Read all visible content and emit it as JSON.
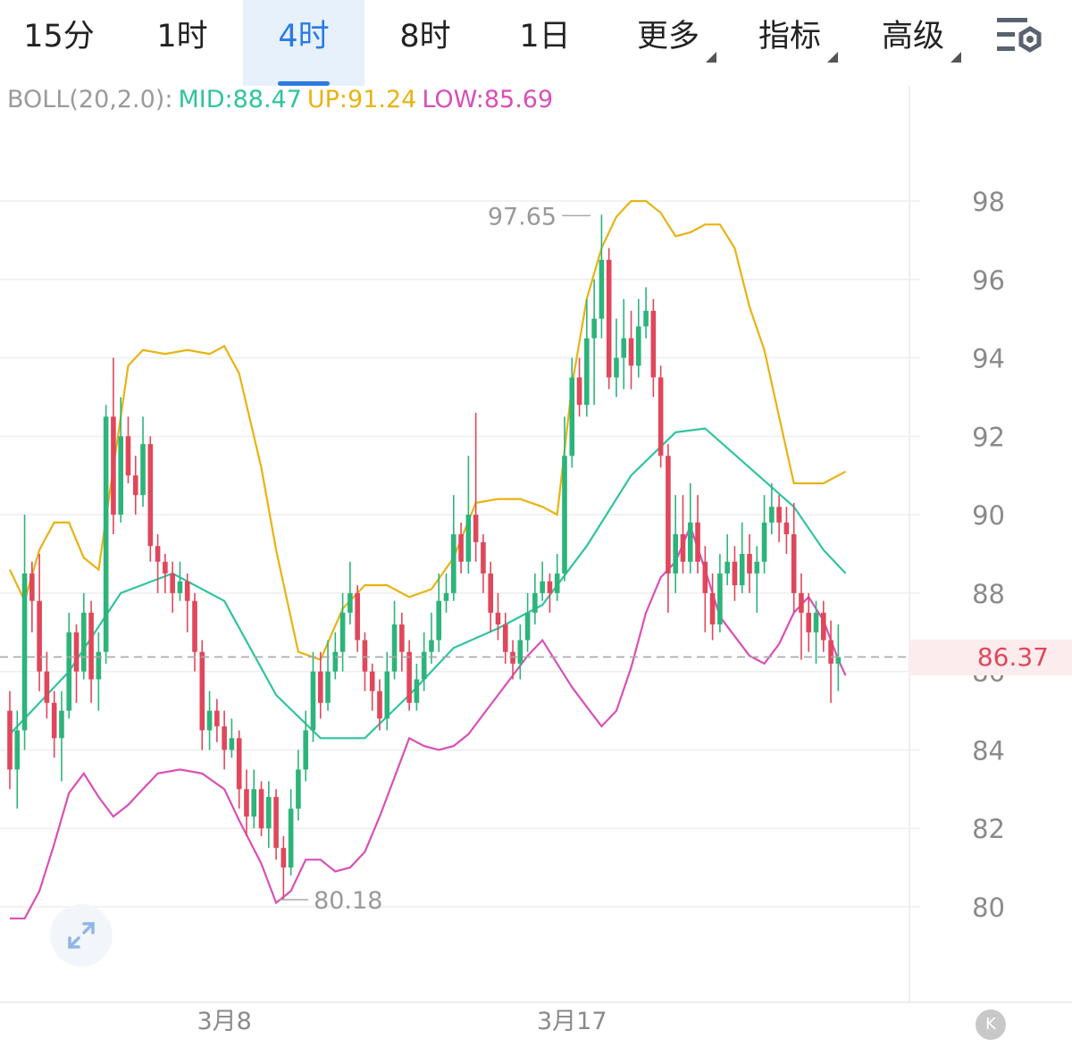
{
  "tabs": [
    {
      "label": "15分",
      "active": false,
      "dropdown": false
    },
    {
      "label": "1时",
      "active": false,
      "dropdown": false
    },
    {
      "label": "4时",
      "active": true,
      "dropdown": false
    },
    {
      "label": "8时",
      "active": false,
      "dropdown": false
    },
    {
      "label": "1日",
      "active": false,
      "dropdown": false
    },
    {
      "label": "更多",
      "active": false,
      "dropdown": true
    },
    {
      "label": "指标",
      "active": false,
      "dropdown": true
    },
    {
      "label": "高级",
      "active": false,
      "dropdown": true
    }
  ],
  "settings_icon": "chart-settings-icon",
  "indicator": {
    "name": "BOLL(20,2.0):",
    "mid_label": "MID:88.47",
    "up_label": "UP:91.24",
    "low_label": "LOW:85.69",
    "name_color": "#9a9a9a",
    "mid_color": "#2ec4a0",
    "up_color": "#e8b313",
    "low_color": "#d94fb7"
  },
  "current_price": "86.37",
  "expand_icon": "expand-icon",
  "k_button_icon": "k-line-icon",
  "chart_data": {
    "type": "candlestick",
    "ylim": [
      78.0,
      99.8
    ],
    "y_ticks": [
      "80",
      "82",
      "84",
      "86",
      "88",
      "90",
      "92",
      "94",
      "96",
      "98"
    ],
    "x_tick_labels": [
      {
        "label": "3月8",
        "index": 29
      },
      {
        "label": "3月17",
        "index": 76
      }
    ],
    "max_annotation": {
      "label": "97.65",
      "value": 97.65,
      "index": 79
    },
    "min_annotation": {
      "label": "80.18",
      "value": 80.18,
      "index": 36
    },
    "current_price_line": 86.37,
    "colors": {
      "up": "#2db47a",
      "down": "#e0475b",
      "mid": "#2ec4a0",
      "upper": "#e8b313",
      "lower": "#d94fb7",
      "grid": "#eeeeee",
      "axis_text": "#8a8a8a"
    },
    "candles": [
      [
        85.0,
        83.5,
        85.5,
        83.0
      ],
      [
        83.5,
        84.5,
        85.0,
        82.5
      ],
      [
        84.5,
        88.5,
        90.0,
        84.0
      ],
      [
        88.5,
        87.8,
        88.8,
        87.0
      ],
      [
        87.8,
        86.0,
        89.0,
        85.5
      ],
      [
        86.0,
        85.2,
        86.5,
        84.8
      ],
      [
        85.2,
        84.3,
        85.5,
        83.8
      ],
      [
        84.3,
        85.0,
        85.5,
        83.2
      ],
      [
        85.0,
        87.0,
        87.5,
        84.8
      ],
      [
        87.0,
        86.0,
        87.2,
        85.2
      ],
      [
        86.0,
        87.5,
        88.0,
        85.8
      ],
      [
        87.5,
        85.8,
        87.8,
        85.2
      ],
      [
        85.8,
        86.5,
        87.0,
        85.0
      ],
      [
        86.5,
        92.5,
        92.8,
        86.2
      ],
      [
        92.5,
        90.0,
        94.0,
        89.5
      ],
      [
        90.0,
        92.0,
        93.0,
        89.8
      ],
      [
        92.0,
        91.0,
        92.5,
        90.8
      ],
      [
        91.0,
        90.5,
        91.5,
        90.0
      ],
      [
        90.5,
        91.8,
        92.5,
        90.2
      ],
      [
        91.8,
        89.2,
        92.0,
        88.8
      ],
      [
        89.2,
        88.8,
        89.5,
        88.0
      ],
      [
        88.8,
        88.5,
        89.0,
        88.0
      ],
      [
        88.5,
        88.0,
        88.8,
        87.5
      ],
      [
        88.0,
        88.3,
        88.8,
        87.8
      ],
      [
        88.3,
        87.8,
        88.5,
        87.0
      ],
      [
        87.8,
        86.5,
        88.0,
        86.0
      ],
      [
        86.5,
        84.5,
        86.8,
        84.0
      ],
      [
        84.5,
        85.0,
        85.5,
        84.0
      ],
      [
        85.0,
        84.6,
        85.3,
        84.2
      ],
      [
        84.6,
        84.0,
        85.0,
        83.5
      ],
      [
        84.0,
        84.3,
        84.8,
        83.8
      ],
      [
        84.3,
        83.0,
        84.5,
        82.5
      ],
      [
        83.0,
        82.3,
        83.5,
        81.8
      ],
      [
        82.3,
        83.0,
        83.5,
        82.0
      ],
      [
        83.0,
        82.0,
        83.2,
        81.8
      ],
      [
        82.0,
        82.8,
        83.2,
        81.5
      ],
      [
        82.8,
        81.5,
        83.0,
        81.2
      ],
      [
        81.5,
        81.0,
        81.8,
        80.18
      ],
      [
        81.0,
        82.5,
        83.0,
        80.8
      ],
      [
        82.5,
        83.5,
        84.0,
        82.2
      ],
      [
        83.5,
        84.5,
        85.0,
        83.2
      ],
      [
        84.5,
        86.0,
        86.5,
        84.2
      ],
      [
        86.0,
        85.2,
        86.5,
        84.8
      ],
      [
        85.2,
        86.0,
        86.8,
        85.0
      ],
      [
        86.0,
        86.5,
        87.0,
        85.8
      ],
      [
        86.5,
        87.5,
        88.0,
        86.0
      ],
      [
        87.5,
        88.0,
        88.8,
        87.2
      ],
      [
        88.0,
        86.8,
        88.2,
        86.5
      ],
      [
        86.8,
        86.0,
        87.0,
        85.5
      ],
      [
        86.0,
        85.5,
        86.2,
        85.0
      ],
      [
        85.5,
        84.8,
        85.8,
        84.5
      ],
      [
        84.8,
        86.0,
        86.5,
        84.5
      ],
      [
        86.0,
        87.2,
        87.8,
        85.8
      ],
      [
        87.2,
        86.5,
        87.5,
        86.0
      ],
      [
        86.5,
        85.2,
        86.8,
        85.0
      ],
      [
        85.2,
        85.8,
        86.2,
        85.0
      ],
      [
        85.8,
        86.5,
        87.0,
        85.5
      ],
      [
        86.5,
        86.8,
        87.5,
        86.2
      ],
      [
        86.8,
        87.8,
        88.5,
        86.5
      ],
      [
        87.8,
        88.0,
        88.5,
        87.5
      ],
      [
        88.0,
        89.5,
        90.5,
        87.8
      ],
      [
        89.5,
        88.8,
        89.8,
        88.5
      ],
      [
        88.8,
        90.0,
        91.5,
        88.5
      ],
      [
        90.0,
        89.3,
        92.6,
        88.8
      ],
      [
        89.3,
        88.5,
        89.5,
        88.0
      ],
      [
        88.5,
        87.5,
        88.8,
        87.0
      ],
      [
        87.5,
        87.2,
        88.0,
        86.8
      ],
      [
        87.2,
        86.5,
        87.5,
        86.2
      ],
      [
        86.5,
        86.2,
        86.8,
        85.8
      ],
      [
        86.2,
        86.8,
        87.2,
        85.8
      ],
      [
        86.8,
        87.5,
        88.0,
        86.5
      ],
      [
        87.5,
        88.0,
        88.5,
        87.2
      ],
      [
        88.0,
        88.3,
        88.8,
        87.8
      ],
      [
        88.3,
        88.0,
        88.5,
        87.5
      ],
      [
        88.0,
        88.5,
        89.0,
        87.8
      ],
      [
        88.5,
        91.5,
        92.5,
        88.3
      ],
      [
        91.5,
        93.5,
        94.0,
        91.2
      ],
      [
        93.5,
        92.8,
        94.0,
        92.5
      ],
      [
        92.8,
        94.5,
        95.5,
        92.5
      ],
      [
        94.5,
        95.0,
        96.0,
        92.8
      ],
      [
        95.0,
        96.5,
        97.65,
        94.5
      ],
      [
        96.5,
        93.5,
        96.8,
        93.2
      ],
      [
        93.5,
        94.0,
        95.0,
        93.0
      ],
      [
        94.0,
        94.5,
        95.5,
        93.2
      ],
      [
        94.5,
        93.8,
        95.2,
        93.2
      ],
      [
        93.8,
        94.8,
        95.5,
        93.5
      ],
      [
        94.8,
        95.2,
        95.8,
        94.5
      ],
      [
        95.2,
        93.5,
        95.5,
        93.0
      ],
      [
        93.5,
        91.5,
        93.8,
        91.2
      ],
      [
        91.5,
        88.5,
        91.8,
        87.5
      ],
      [
        88.5,
        89.5,
        90.5,
        88.0
      ],
      [
        89.5,
        88.8,
        90.5,
        88.5
      ],
      [
        88.8,
        89.8,
        90.8,
        88.5
      ],
      [
        89.8,
        88.8,
        90.5,
        88.5
      ],
      [
        88.8,
        88.0,
        89.2,
        87.0
      ],
      [
        88.0,
        87.2,
        88.5,
        86.8
      ],
      [
        87.2,
        88.5,
        89.0,
        87.0
      ],
      [
        88.5,
        88.8,
        89.5,
        88.2
      ],
      [
        88.8,
        88.2,
        89.2,
        87.8
      ],
      [
        88.2,
        89.0,
        89.8,
        88.0
      ],
      [
        89.0,
        88.5,
        89.5,
        88.0
      ],
      [
        88.5,
        88.8,
        89.2,
        87.5
      ],
      [
        88.8,
        89.8,
        90.5,
        88.5
      ],
      [
        89.8,
        90.2,
        90.8,
        89.5
      ],
      [
        90.2,
        89.8,
        90.5,
        89.3
      ],
      [
        89.8,
        89.5,
        90.2,
        89.0
      ],
      [
        89.5,
        88.0,
        90.3,
        87.5
      ],
      [
        88.0,
        87.5,
        88.5,
        86.3
      ],
      [
        87.5,
        87.0,
        88.0,
        86.5
      ],
      [
        87.0,
        87.5,
        87.8,
        86.2
      ],
      [
        87.5,
        86.8,
        87.8,
        86.5
      ],
      [
        86.8,
        86.2,
        87.3,
        85.2
      ],
      [
        86.2,
        86.37,
        87.2,
        85.5
      ]
    ],
    "mid": [
      [
        0,
        84.4
      ],
      [
        8,
        86.0
      ],
      [
        15,
        88.0
      ],
      [
        22,
        88.5
      ],
      [
        29,
        87.8
      ],
      [
        36,
        85.4
      ],
      [
        42,
        84.3
      ],
      [
        48,
        84.3
      ],
      [
        54,
        85.4
      ],
      [
        60,
        86.6
      ],
      [
        66,
        87.1
      ],
      [
        72,
        87.7
      ],
      [
        78,
        89.2
      ],
      [
        84,
        91.0
      ],
      [
        90,
        92.1
      ],
      [
        94,
        92.2
      ],
      [
        100,
        91.2
      ],
      [
        106,
        90.2
      ],
      [
        110,
        89.1
      ],
      [
        113,
        88.5
      ]
    ],
    "upper": [
      [
        0,
        88.6
      ],
      [
        2,
        87.8
      ],
      [
        4,
        89.1
      ],
      [
        6,
        89.8
      ],
      [
        8,
        89.8
      ],
      [
        10,
        88.9
      ],
      [
        12,
        88.6
      ],
      [
        14,
        91.2
      ],
      [
        16,
        93.8
      ],
      [
        18,
        94.2
      ],
      [
        21,
        94.1
      ],
      [
        24,
        94.2
      ],
      [
        27,
        94.1
      ],
      [
        29,
        94.3
      ],
      [
        31,
        93.6
      ],
      [
        34,
        91.2
      ],
      [
        36,
        89.1
      ],
      [
        39,
        86.5
      ],
      [
        42,
        86.3
      ],
      [
        45,
        87.6
      ],
      [
        48,
        88.2
      ],
      [
        51,
        88.2
      ],
      [
        54,
        87.9
      ],
      [
        57,
        88.1
      ],
      [
        60,
        88.9
      ],
      [
        63,
        90.3
      ],
      [
        66,
        90.4
      ],
      [
        69,
        90.4
      ],
      [
        72,
        90.2
      ],
      [
        74,
        90.0
      ],
      [
        76,
        93.3
      ],
      [
        78,
        95.5
      ],
      [
        80,
        96.8
      ],
      [
        82,
        97.6
      ],
      [
        84,
        98.0
      ],
      [
        86,
        98.0
      ],
      [
        88,
        97.7
      ],
      [
        90,
        97.1
      ],
      [
        92,
        97.2
      ],
      [
        94,
        97.4
      ],
      [
        96,
        97.4
      ],
      [
        98,
        96.8
      ],
      [
        100,
        95.3
      ],
      [
        102,
        94.2
      ],
      [
        104,
        92.5
      ],
      [
        106,
        90.8
      ],
      [
        107,
        90.8
      ],
      [
        110,
        90.8
      ],
      [
        113,
        91.1
      ]
    ],
    "lower": [
      [
        0,
        79.7
      ],
      [
        2,
        79.7
      ],
      [
        4,
        80.4
      ],
      [
        6,
        81.6
      ],
      [
        8,
        82.9
      ],
      [
        10,
        83.4
      ],
      [
        12,
        82.8
      ],
      [
        14,
        82.3
      ],
      [
        16,
        82.6
      ],
      [
        18,
        83.0
      ],
      [
        20,
        83.4
      ],
      [
        23,
        83.5
      ],
      [
        26,
        83.4
      ],
      [
        29,
        83.0
      ],
      [
        31,
        82.2
      ],
      [
        34,
        81.1
      ],
      [
        36,
        80.1
      ],
      [
        38,
        80.4
      ],
      [
        40,
        81.2
      ],
      [
        42,
        81.2
      ],
      [
        44,
        80.9
      ],
      [
        46,
        81.0
      ],
      [
        48,
        81.4
      ],
      [
        50,
        82.3
      ],
      [
        52,
        83.3
      ],
      [
        54,
        84.3
      ],
      [
        56,
        84.1
      ],
      [
        58,
        84.0
      ],
      [
        60,
        84.1
      ],
      [
        62,
        84.4
      ],
      [
        64,
        84.9
      ],
      [
        66,
        85.4
      ],
      [
        68,
        85.9
      ],
      [
        70,
        86.4
      ],
      [
        72,
        86.8
      ],
      [
        74,
        86.2
      ],
      [
        76,
        85.6
      ],
      [
        78,
        85.1
      ],
      [
        80,
        84.6
      ],
      [
        82,
        85.0
      ],
      [
        84,
        86.1
      ],
      [
        86,
        87.5
      ],
      [
        88,
        88.4
      ],
      [
        90,
        88.8
      ],
      [
        92,
        89.7
      ],
      [
        94,
        88.6
      ],
      [
        96,
        87.4
      ],
      [
        98,
        86.9
      ],
      [
        100,
        86.4
      ],
      [
        102,
        86.2
      ],
      [
        104,
        86.7
      ],
      [
        106,
        87.5
      ],
      [
        108,
        87.9
      ],
      [
        110,
        87.3
      ],
      [
        112,
        86.3
      ],
      [
        113,
        85.9
      ]
    ]
  }
}
